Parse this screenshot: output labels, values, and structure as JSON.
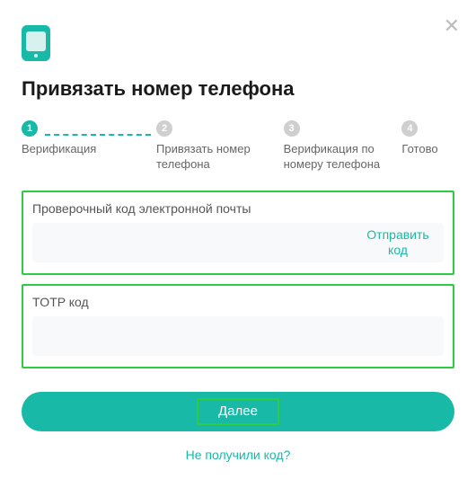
{
  "title": "Привязать номер телефона",
  "steps": [
    {
      "num": "1",
      "label": "Верификация",
      "active": true
    },
    {
      "num": "2",
      "label": "Привязать номер телефона",
      "active": false
    },
    {
      "num": "3",
      "label": "Верификация по номеру телефона",
      "active": false
    },
    {
      "num": "4",
      "label": "Готово",
      "active": false
    }
  ],
  "email_code": {
    "label": "Проверочный код электронной почты",
    "value": "",
    "send_label": "Отправить код"
  },
  "totp": {
    "label": "TOTP код",
    "value": ""
  },
  "next_label": "Далее",
  "no_code_link": "Не получили код?",
  "colors": {
    "accent": "#19b9a7",
    "highlight": "#2ecc40"
  }
}
